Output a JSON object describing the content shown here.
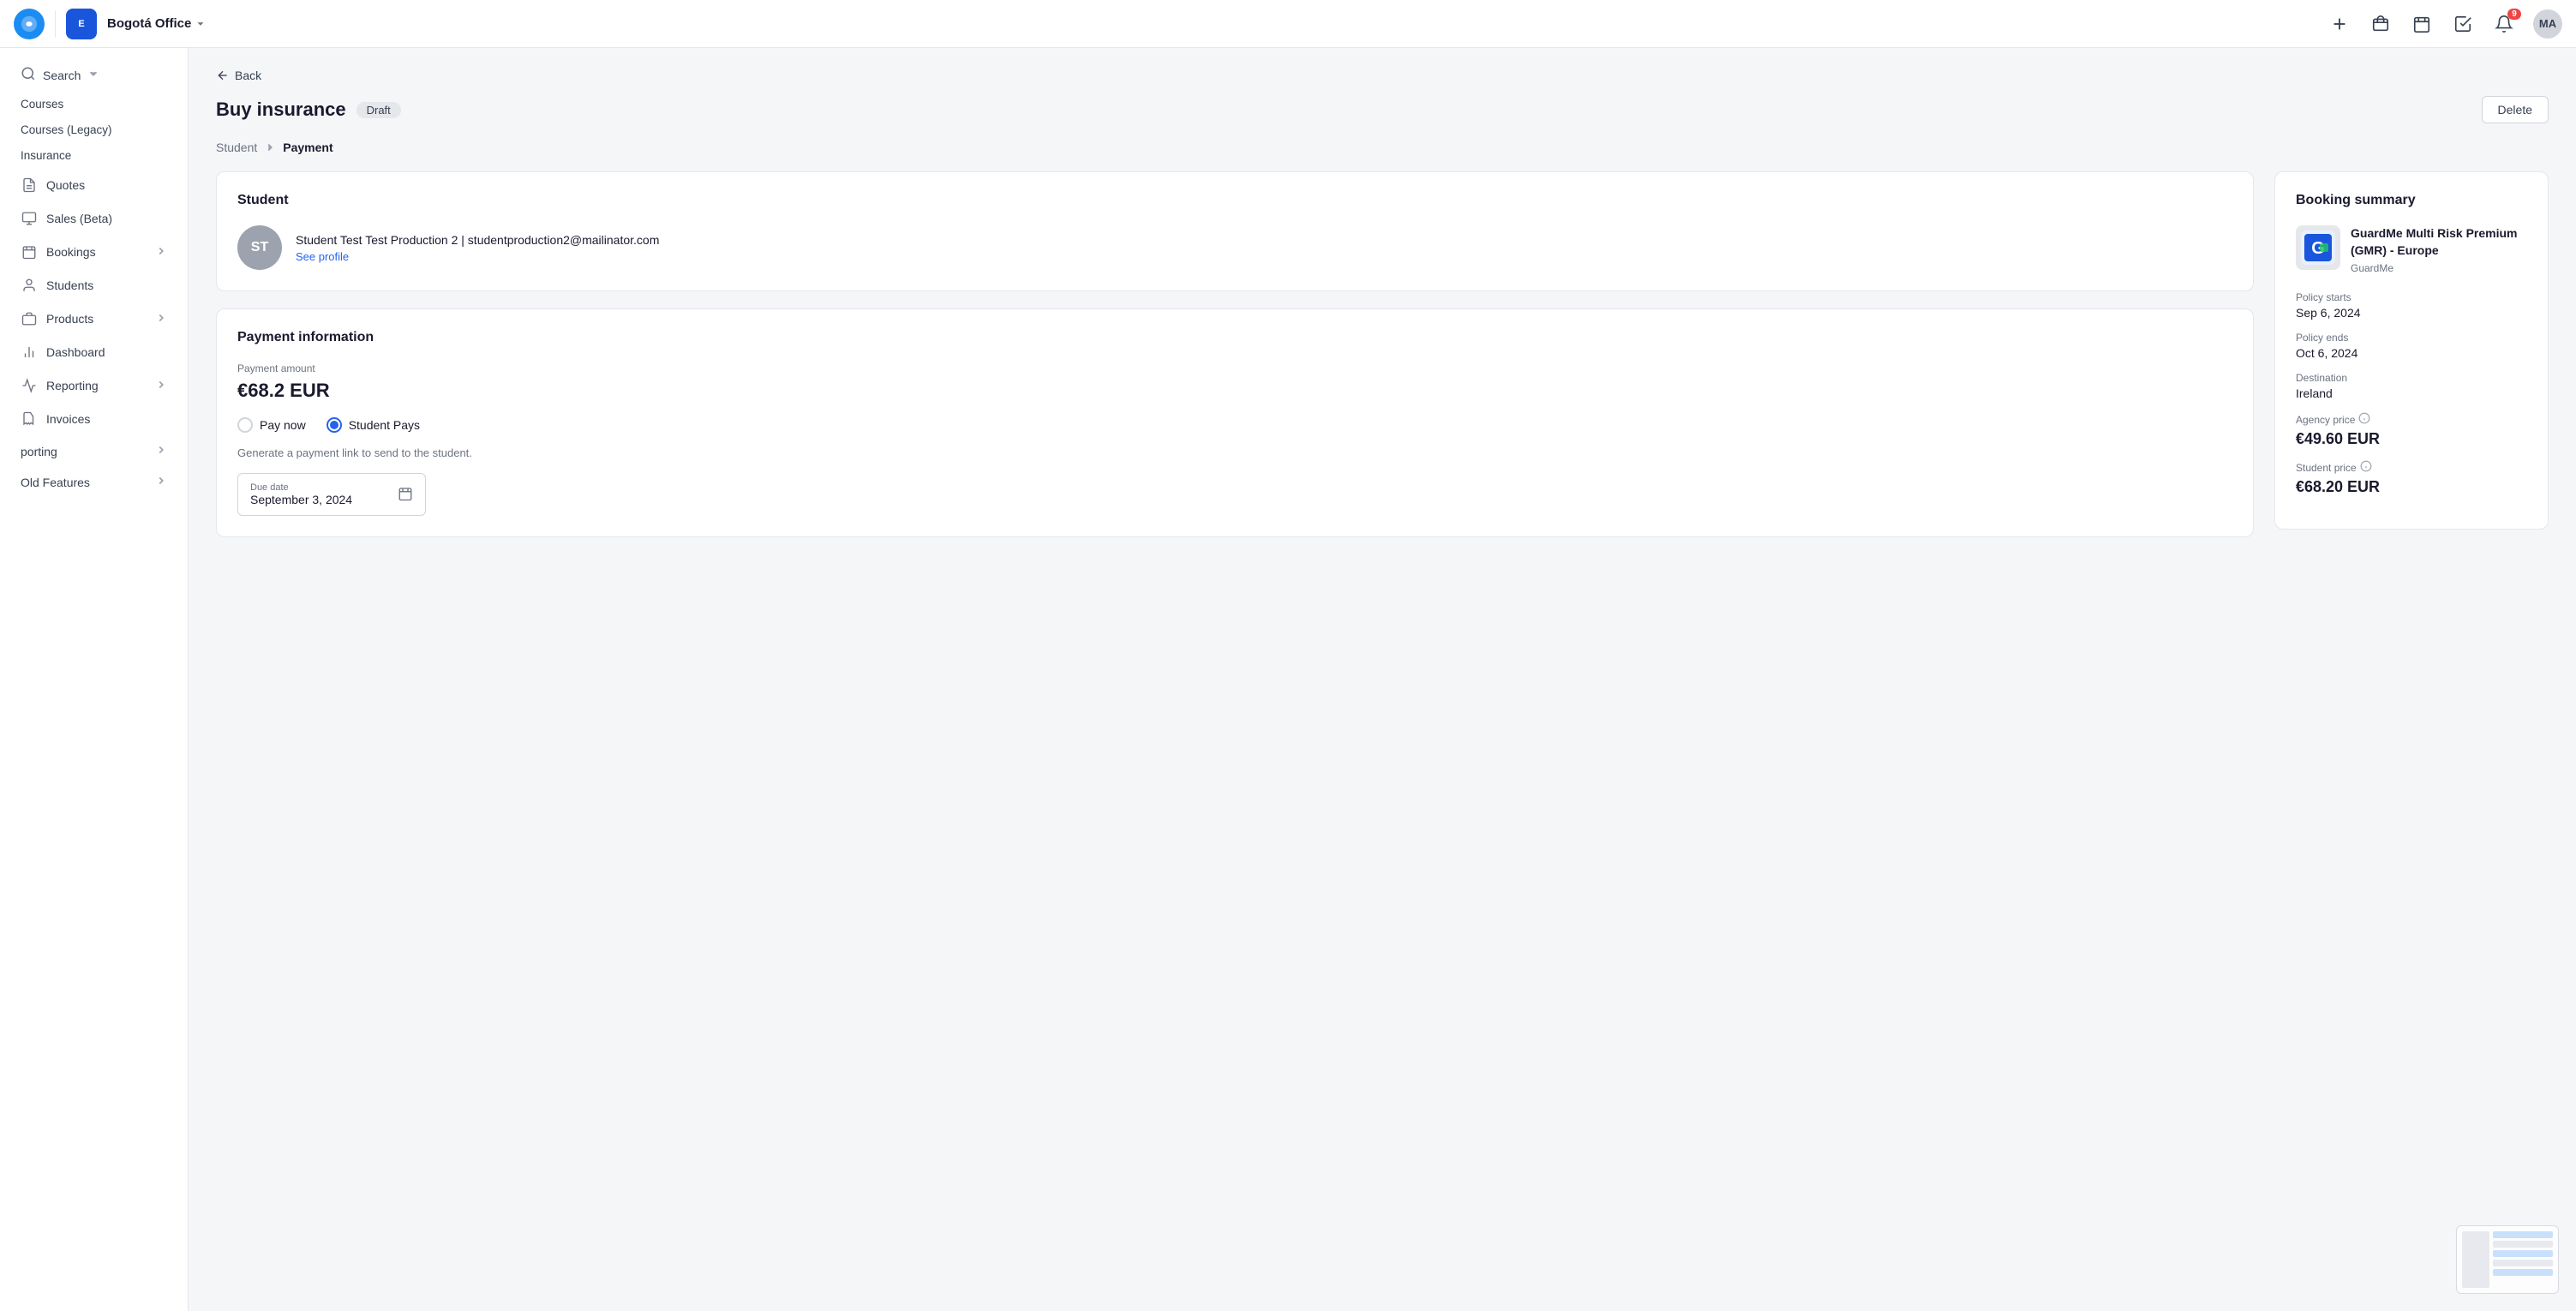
{
  "topbar": {
    "office": "Bogotá Office",
    "chevron": "▾",
    "add_icon": "+",
    "notifications_count": "9",
    "avatar_initials": "MA"
  },
  "sidebar": {
    "search_label": "Search",
    "items": [
      {
        "id": "courses",
        "label": "Courses",
        "has_icon": false,
        "has_chevron": false
      },
      {
        "id": "courses-legacy",
        "label": "Courses (Legacy)",
        "has_icon": false,
        "has_chevron": false
      },
      {
        "id": "insurance",
        "label": "Insurance",
        "has_icon": false,
        "has_chevron": false
      },
      {
        "id": "quotes",
        "label": "Quotes",
        "has_icon": true,
        "icon": "quotes",
        "has_chevron": false
      },
      {
        "id": "sales-beta",
        "label": "Sales (Beta)",
        "has_icon": true,
        "icon": "sales",
        "has_chevron": false
      },
      {
        "id": "bookings",
        "label": "Bookings",
        "has_icon": true,
        "icon": "bookings",
        "has_chevron": true
      },
      {
        "id": "students",
        "label": "Students",
        "has_icon": true,
        "icon": "students",
        "has_chevron": false
      },
      {
        "id": "products",
        "label": "Products",
        "has_icon": true,
        "icon": "products",
        "has_chevron": true
      },
      {
        "id": "dashboard",
        "label": "Dashboard",
        "has_icon": true,
        "icon": "dashboard",
        "has_chevron": false
      },
      {
        "id": "reporting",
        "label": "Reporting",
        "has_icon": true,
        "icon": "reporting",
        "has_chevron": true
      },
      {
        "id": "invoices",
        "label": "Invoices",
        "has_icon": true,
        "icon": "invoices",
        "has_chevron": false
      },
      {
        "id": "porting",
        "label": "porting",
        "has_icon": false,
        "has_chevron": true
      },
      {
        "id": "old-features",
        "label": "Old Features",
        "has_icon": false,
        "has_chevron": true
      }
    ]
  },
  "back": "Back",
  "page_title": "Buy insurance",
  "status_badge": "Draft",
  "delete_button": "Delete",
  "breadcrumb": {
    "student": "Student",
    "payment": "Payment"
  },
  "student_card": {
    "title": "Student",
    "avatar_initials": "ST",
    "name": "Student Test Test Production 2 | studentproduction2@mailinator.com",
    "see_profile": "See profile"
  },
  "payment_card": {
    "title": "Payment information",
    "payment_label": "Payment amount",
    "payment_amount": "€68.2 EUR",
    "pay_now": "Pay now",
    "student_pays": "Student Pays",
    "student_pays_selected": true,
    "hint": "Generate a payment link to send to the student.",
    "due_date_label": "Due date",
    "due_date_value": "September 3, 2024"
  },
  "booking_summary": {
    "title": "Booking summary",
    "product_name": "GuardMe Multi Risk Premium (GMR) - Europe",
    "provider": "GuardMe",
    "policy_starts_label": "Policy starts",
    "policy_starts": "Sep 6, 2024",
    "policy_ends_label": "Policy ends",
    "policy_ends": "Oct 6, 2024",
    "destination_label": "Destination",
    "destination": "Ireland",
    "agency_price_label": "Agency price",
    "agency_price": "€49.60 EUR",
    "student_price_label": "Student price",
    "student_price": "€68.20 EUR"
  }
}
